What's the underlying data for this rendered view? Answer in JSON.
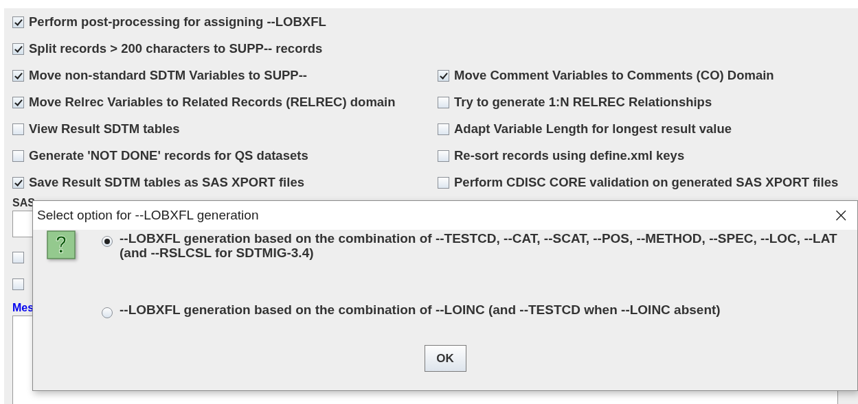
{
  "checkbox_rows": [
    {
      "left": {
        "label": "Perform post-processing for assigning --LOBXFL",
        "checked": true
      }
    },
    {
      "left": {
        "label": "Split records > 200 characters to SUPP-- records",
        "checked": true
      }
    },
    {
      "left": {
        "label": "Move non-standard SDTM Variables to SUPP--",
        "checked": true
      },
      "right": {
        "label": "Move Comment Variables to Comments (CO) Domain",
        "checked": true
      }
    },
    {
      "left": {
        "label": "Move Relrec Variables to Related Records (RELREC) domain",
        "checked": true
      },
      "right": {
        "label": "Try to generate 1:N RELREC Relationships",
        "checked": false
      }
    },
    {
      "left": {
        "label": "View Result SDTM tables",
        "checked": false
      },
      "right": {
        "label": "Adapt Variable Length for longest result value",
        "checked": false
      }
    },
    {
      "left": {
        "label": "Generate 'NOT DONE' records for QS datasets",
        "checked": false
      },
      "right": {
        "label": "Re-sort records using define.xml keys",
        "checked": false
      }
    },
    {
      "left": {
        "label": "Save Result SDTM tables as SAS XPORT files",
        "checked": true
      },
      "right": {
        "label": "Perform CDISC CORE validation on generated SAS XPORT files",
        "checked": false
      }
    }
  ],
  "sas_label": "SAS",
  "lower_checkboxes": [
    {
      "checked": false
    },
    {
      "checked": false
    }
  ],
  "messages_label": "Mes",
  "dialog": {
    "title": "Select option for --LOBXFL generation",
    "close": "×",
    "options": [
      {
        "label": "--LOBXFL generation based on the combination of --TESTCD, --CAT, --SCAT, --POS, --METHOD, --SPEC, --LOC, --LAT (and --RSLCSL for SDTMIG-3.4)",
        "selected": true
      },
      {
        "label": "--LOBXFL generation based on the combination of --LOINC (and --TESTCD when --LOINC absent)",
        "selected": false
      }
    ],
    "ok": "OK"
  }
}
